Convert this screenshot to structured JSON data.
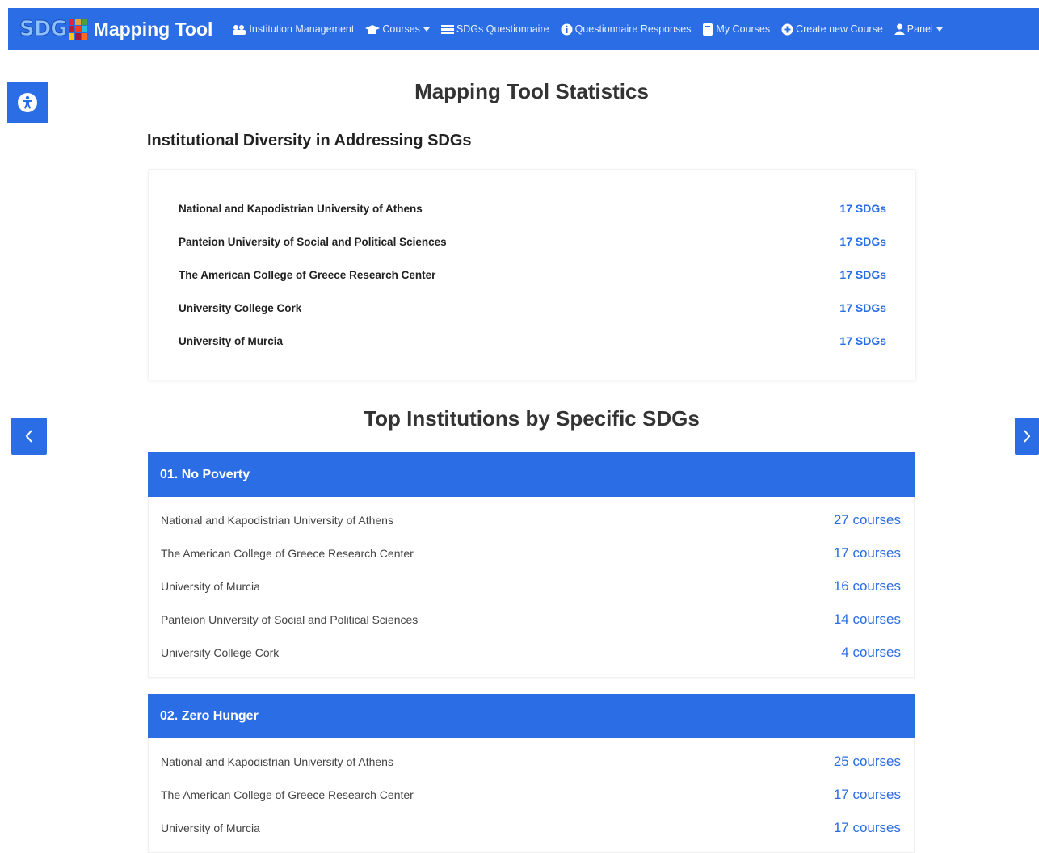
{
  "nav": {
    "logo_text": "SDG",
    "brand": "Mapping Tool",
    "items": [
      {
        "label": "Institution Management",
        "icon": "institution-icon",
        "dropdown": false
      },
      {
        "label": "Courses",
        "icon": "graduation-cap-icon",
        "dropdown": true
      },
      {
        "label": "SDGs Questionnaire",
        "icon": "list-icon",
        "dropdown": false
      },
      {
        "label": "Questionnaire Responses",
        "icon": "info-circle-icon",
        "dropdown": false
      },
      {
        "label": "My Courses",
        "icon": "book-icon",
        "dropdown": false
      },
      {
        "label": "Create new Course",
        "icon": "plus-circle-icon",
        "dropdown": false
      },
      {
        "label": "Panel",
        "icon": "user-icon",
        "dropdown": true
      }
    ]
  },
  "page": {
    "title": "Mapping Tool Statistics",
    "diversity_title": "Institutional Diversity in Addressing SDGs",
    "top_title": "Top Institutions by Specific SDGs"
  },
  "diversity": [
    {
      "name": "National and Kapodistrian University of Athens",
      "value": "17 SDGs"
    },
    {
      "name": "Panteion University of Social and Political Sciences",
      "value": "17 SDGs"
    },
    {
      "name": "The American College of Greece Research Center",
      "value": "17 SDGs"
    },
    {
      "name": "University College Cork",
      "value": "17 SDGs"
    },
    {
      "name": "University of Murcia",
      "value": "17 SDGs"
    }
  ],
  "sdgs": [
    {
      "title": "01. No Poverty",
      "rows": [
        {
          "name": "National and Kapodistrian University of Athens",
          "value": "27 courses"
        },
        {
          "name": "The American College of Greece Research Center",
          "value": "17 courses"
        },
        {
          "name": "University of Murcia",
          "value": "16 courses"
        },
        {
          "name": "Panteion University of Social and Political Sciences",
          "value": "14 courses"
        },
        {
          "name": "University College Cork",
          "value": "4 courses"
        }
      ]
    },
    {
      "title": "02. Zero Hunger",
      "rows": [
        {
          "name": "National and Kapodistrian University of Athens",
          "value": "25 courses"
        },
        {
          "name": "The American College of Greece Research Center",
          "value": "17 courses"
        },
        {
          "name": "University of Murcia",
          "value": "17 courses"
        }
      ]
    }
  ],
  "colors": {
    "primary": "#2b6de4",
    "text": "#222222"
  }
}
